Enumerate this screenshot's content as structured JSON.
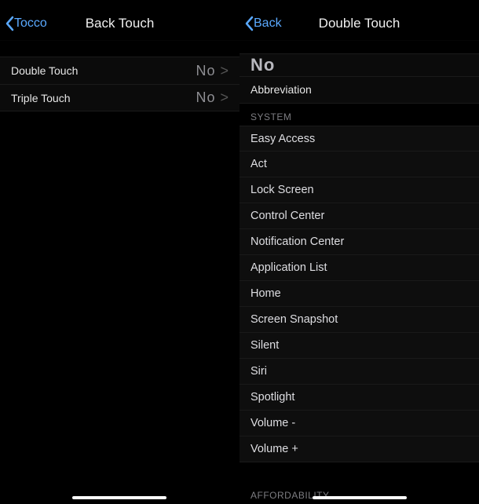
{
  "left": {
    "nav": {
      "back_label": "Tocco",
      "title": "Back Touch"
    },
    "rows": [
      {
        "label": "Double Touch",
        "value": "No"
      },
      {
        "label": "Triple Touch",
        "value": "No"
      }
    ]
  },
  "right": {
    "nav": {
      "back_label": "Back",
      "title": "Double Touch"
    },
    "selected_value": "No",
    "rows": [
      {
        "label": "Abbreviation"
      }
    ],
    "section_system": "SYSTEM",
    "system_items": [
      "Easy Access",
      "Act",
      "Lock Screen",
      "Control Center",
      "Notification Center",
      "Application List",
      "Home",
      "Screen Snapshot",
      "Silent",
      "Siri",
      "Spotlight",
      "Volume -",
      "Volume +"
    ],
    "section_affordability": "AFFORDABILITY"
  },
  "chevron": ">"
}
